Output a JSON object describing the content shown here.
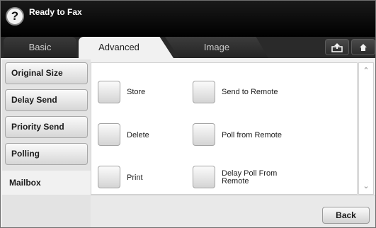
{
  "header": {
    "help_icon": "?",
    "title": "Ready to Fax"
  },
  "tabs": [
    {
      "label": "Basic",
      "active": false
    },
    {
      "label": "Advanced",
      "active": true
    },
    {
      "label": "Image",
      "active": false
    }
  ],
  "toolbar": {
    "upload_icon": "upload-icon",
    "home_icon": "home-icon"
  },
  "sidebar": {
    "items": [
      {
        "label": "Original Size"
      },
      {
        "label": "Delay Send"
      },
      {
        "label": "Priority Send"
      },
      {
        "label": "Polling"
      },
      {
        "label": "Mailbox",
        "active": true
      }
    ]
  },
  "actions": {
    "store": "Store",
    "delete": "Delete",
    "print": "Print",
    "send_to_remote": "Send to Remote",
    "poll_from_remote": "Poll from Remote",
    "delay_poll_line1": "Delay Poll From",
    "delay_poll_line2": "Remote"
  },
  "footer": {
    "back_label": "Back"
  },
  "colors": {
    "titlebar": "#000000",
    "tab_active": "#f1f1f1",
    "accent_text": "#ffffff"
  }
}
